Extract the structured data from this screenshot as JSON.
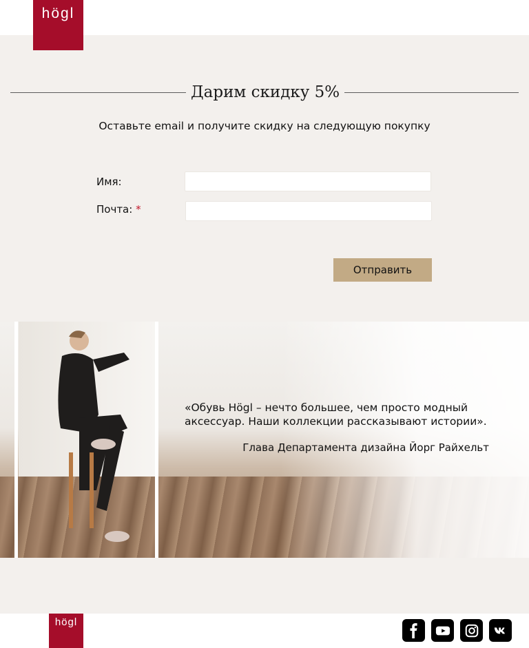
{
  "brand": {
    "logo_text": "högl",
    "accent": "#a50d2a"
  },
  "promo": {
    "title": "Дарим скидку 5%",
    "subtitle": "Оставьте email и получите скидку на следующую покупку"
  },
  "form": {
    "name_label": "Имя:",
    "name_value": "",
    "email_label": "Почта:",
    "required_mark": "*",
    "email_value": "",
    "submit_label": "Отправить",
    "submit_color": "#c2aa85"
  },
  "banner": {
    "quote": "«Обувь Högl – нечто большее, чем просто модный аксессуар. Наши коллекции рассказывают истории».",
    "author": "Глава Департамента дизайна Йорг Райхельт"
  },
  "footer": {
    "logo_text": "högl",
    "social": [
      "facebook-icon",
      "youtube-icon",
      "instagram-icon",
      "vk-icon"
    ]
  }
}
